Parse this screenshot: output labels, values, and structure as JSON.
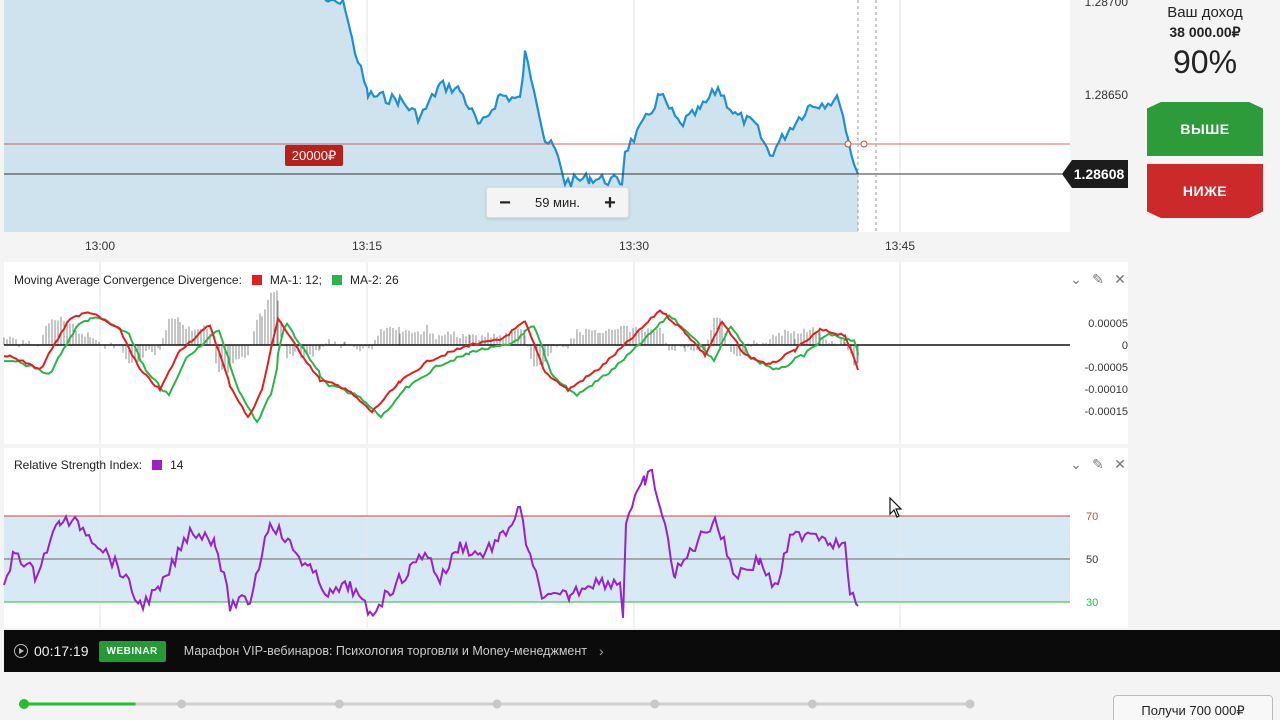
{
  "price_chart": {
    "axis_labels_top": [
      "1.28700",
      "1.28650"
    ],
    "current_price": "1.28608",
    "bet_amount": "20000₽",
    "time_labels": [
      "13:00",
      "13:15",
      "13:30",
      "13:45"
    ],
    "duration": {
      "minus": "−",
      "value": "59 мин.",
      "plus": "+"
    },
    "colors": {
      "line": "#1e90d0",
      "fill": "#cfe3ef",
      "strike": "#c9433f"
    }
  },
  "payout": {
    "label": "Ваш доход",
    "amount": "38 000.00₽",
    "percent": "90%"
  },
  "buttons": {
    "up": "ВЫШЕ",
    "down": "НИЖЕ"
  },
  "macd": {
    "title": "Moving Average Convergence Divergence:",
    "ma1_label": "MA-1: 12;",
    "ma2_label": "MA-2: 26",
    "ma1_color": "#e02020",
    "ma2_color": "#2ab54a",
    "ticks": [
      "0.00005",
      "0",
      "-0.00005",
      "-0.00010",
      "-0.00015"
    ]
  },
  "rsi": {
    "title": "Relative Strength Index:",
    "period": "14",
    "color": "#9a22c8",
    "ticks": [
      "70",
      "50",
      "30"
    ]
  },
  "webinar": {
    "time": "00:17:19",
    "badge": "WEBINAR",
    "title": "Марафон VIP-вебинаров: Психология торговли и Money-менеджмент",
    "chevron": "›"
  },
  "progress": {
    "fraction": 0.118,
    "steps": 7
  },
  "get_button": "Получи 700 000₽"
}
